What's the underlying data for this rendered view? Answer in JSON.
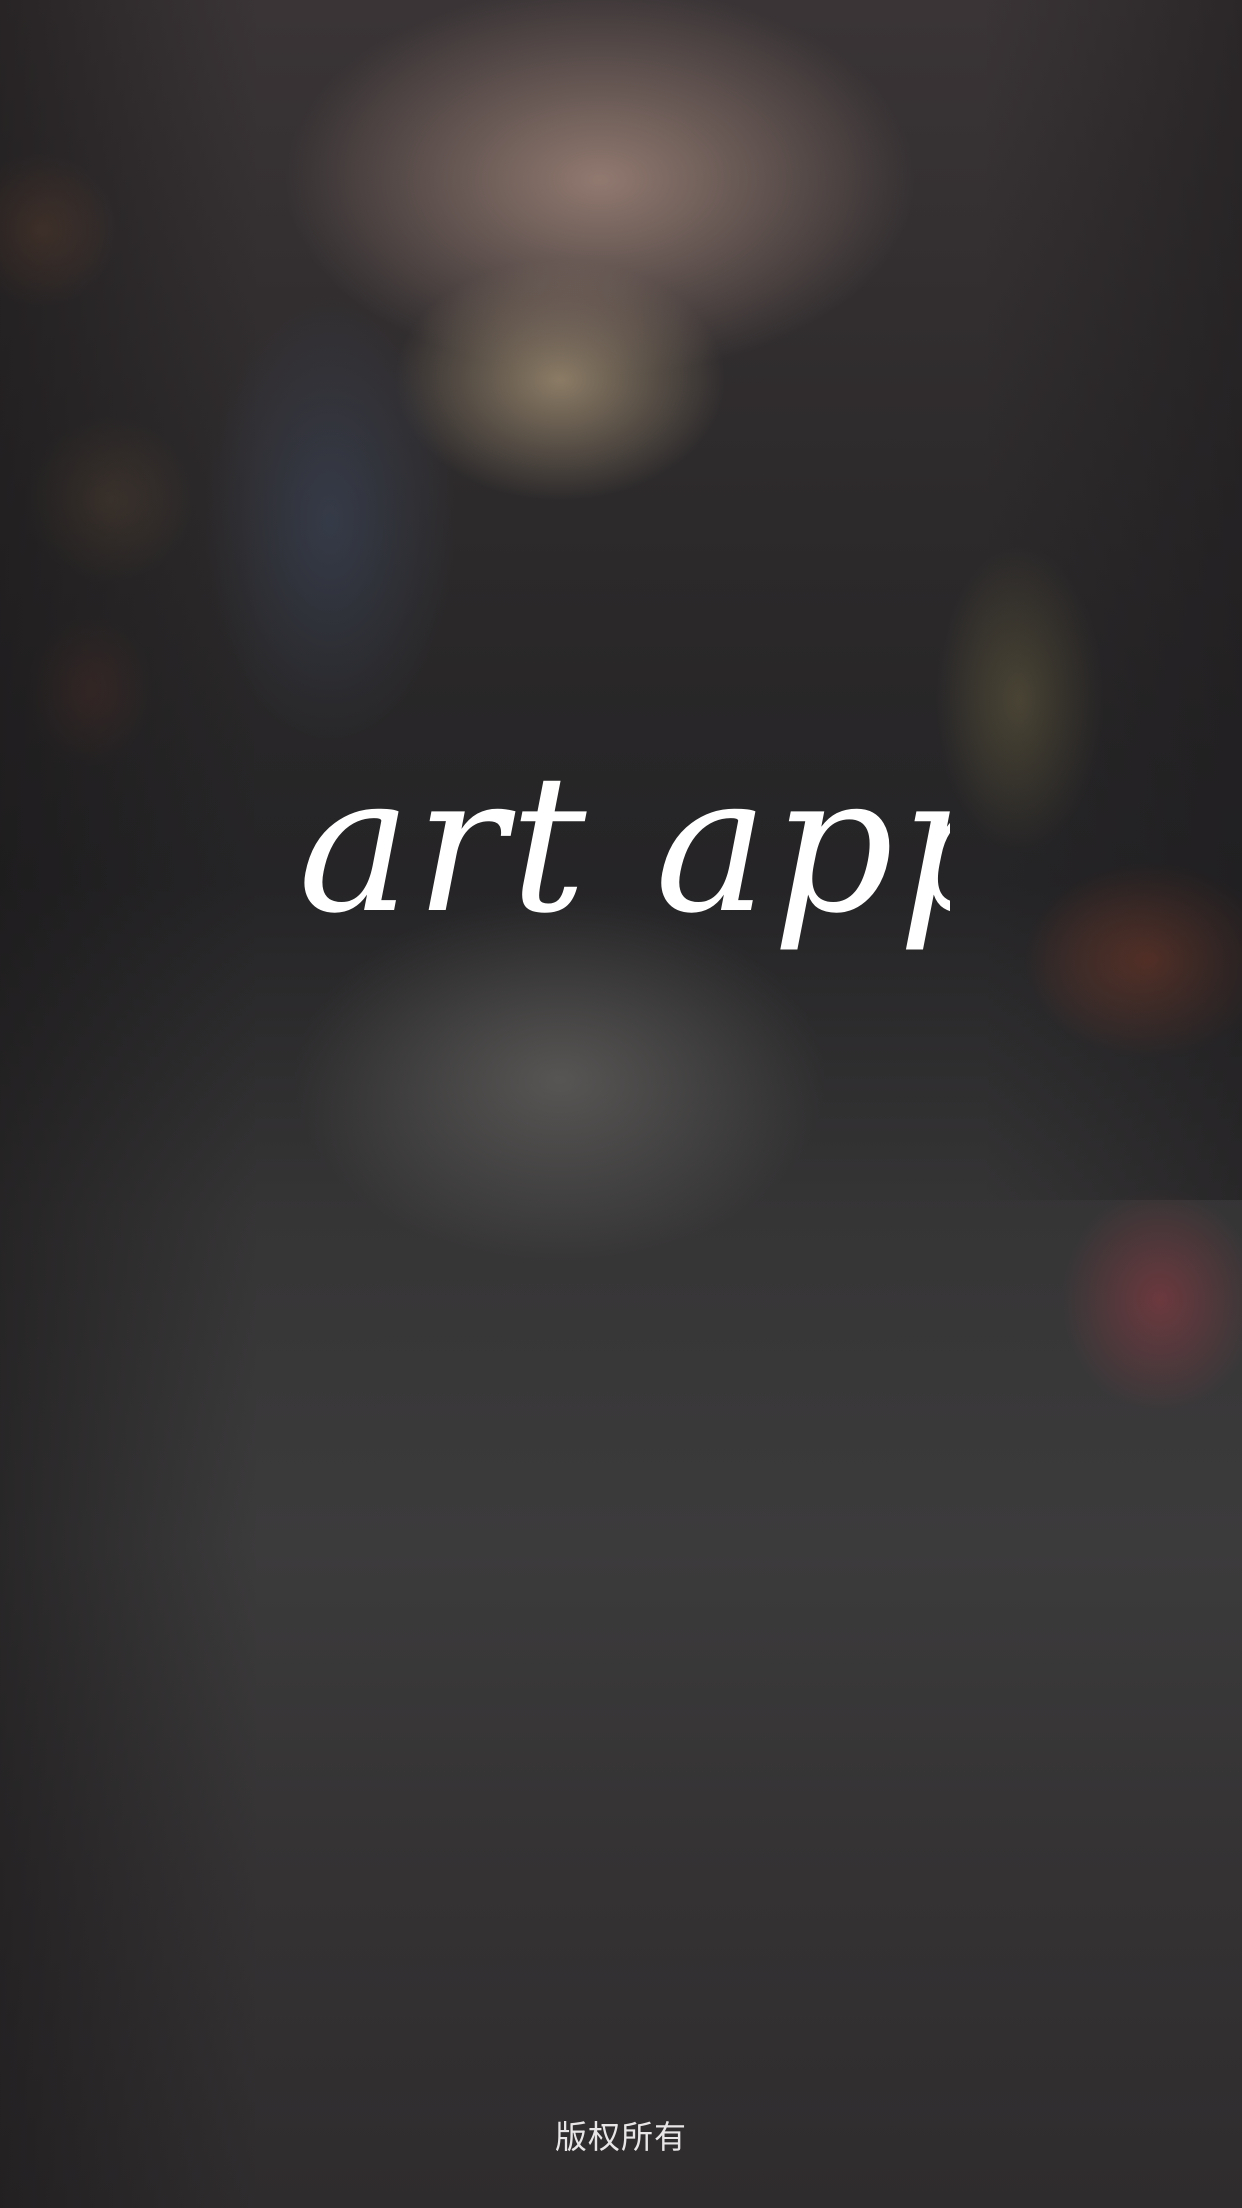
{
  "splash": {
    "logo_text": "art app",
    "copyright": "版权所有"
  },
  "colors": {
    "logo": "#ffffff",
    "footer_text": "#e8e6e6",
    "background_base": "#2e2c2e"
  }
}
